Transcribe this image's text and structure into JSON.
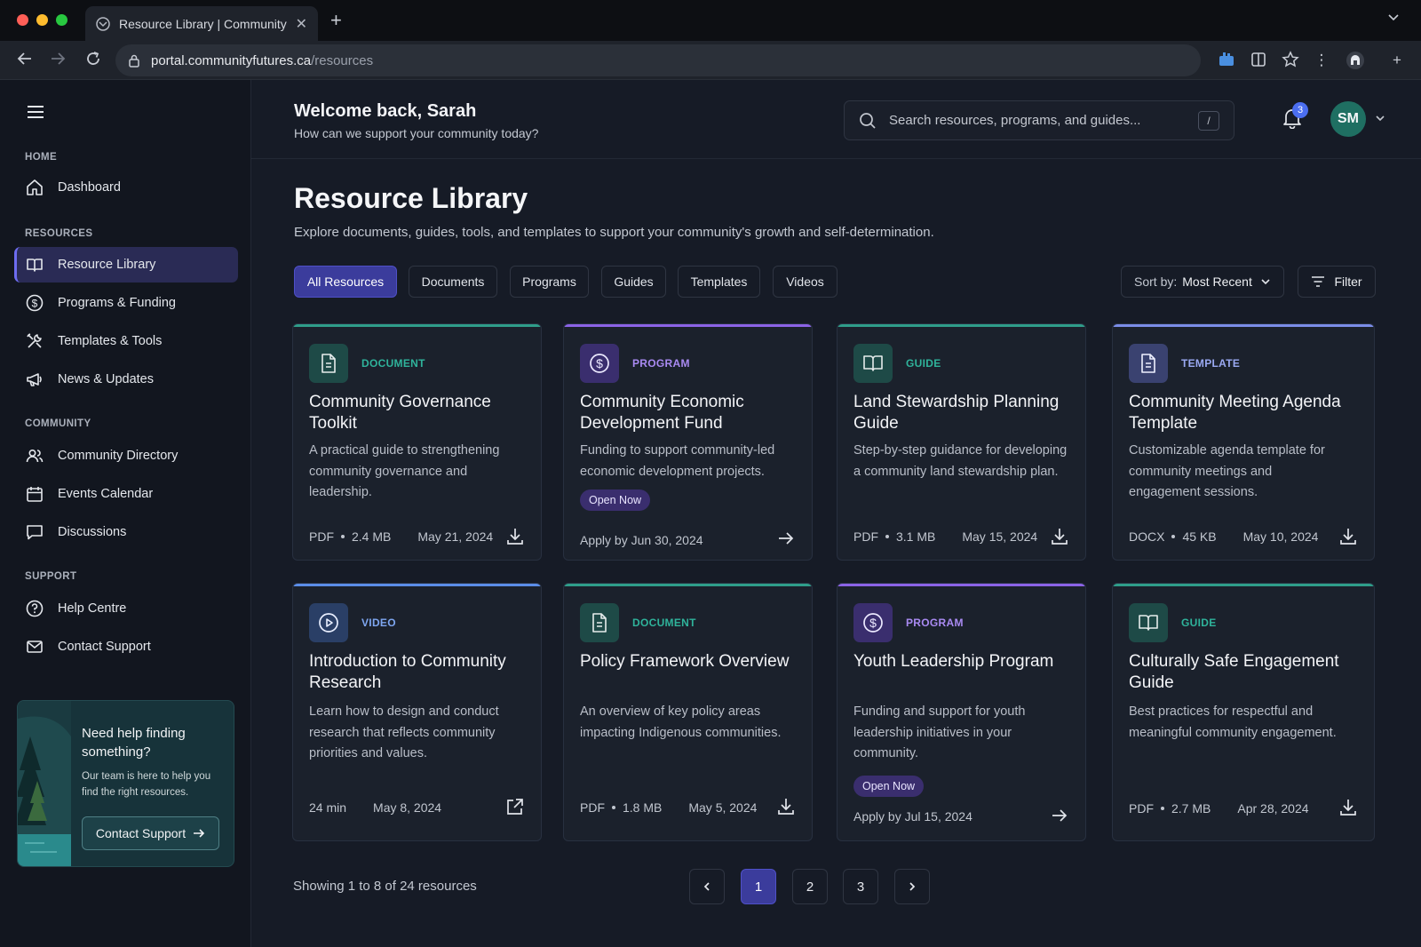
{
  "browser": {
    "tab_title": "Resource Library | Community Futures",
    "url_host": "portal.communityfutures.ca",
    "url_path": "/resources"
  },
  "sidebar": {
    "sections": {
      "home": "HOME",
      "resources": "RESOURCES",
      "community": "COMMUNITY",
      "support": "SUPPORT"
    },
    "items": [
      {
        "label": "Dashboard",
        "icon": "home-icon"
      },
      {
        "label": "Resource Library",
        "icon": "book-icon",
        "active": true
      },
      {
        "label": "Programs & Funding",
        "icon": "dollar-icon"
      },
      {
        "label": "Templates & Tools",
        "icon": "tools-icon"
      },
      {
        "label": "News & Updates",
        "icon": "megaphone-icon"
      },
      {
        "label": "Community Directory",
        "icon": "users-icon"
      },
      {
        "label": "Events Calendar",
        "icon": "calendar-icon"
      },
      {
        "label": "Discussions",
        "icon": "chat-icon"
      },
      {
        "label": "Help Centre",
        "icon": "help-icon"
      },
      {
        "label": "Contact Support",
        "icon": "mail-icon"
      }
    ],
    "help_card": {
      "title": "Need help finding something?",
      "subtitle": "Our team is here to help you find the right resources.",
      "button": "Contact Support"
    }
  },
  "header": {
    "welcome": "Welcome back, Sarah",
    "welcome_sub": "How can we support your community today?",
    "search_placeholder": "Search resources, programs, and guides...",
    "search_shortcut": "/",
    "notification_count": "3",
    "avatar_initials": "SM"
  },
  "page": {
    "title": "Resource Library",
    "description": "Explore documents, guides, tools, and templates to support your community's growth and self-determination."
  },
  "filters": {
    "chips": [
      "All Resources",
      "Documents",
      "Programs",
      "Guides",
      "Templates",
      "Videos"
    ],
    "active_chip": "All Resources",
    "sort_label": "Sort by:",
    "sort_value": "Most Recent",
    "filter_label": "Filter"
  },
  "colors": {
    "document": "#2f9e8a",
    "program": "#8b63e6",
    "guide": "#2f9e8a",
    "template": "#7b8de8",
    "video": "#5b8de8"
  },
  "cards": [
    {
      "type": "DOCUMENT",
      "title": "Community Governance Toolkit",
      "desc": "A practical guide to strengthening community governance and leadership.",
      "format": "PDF",
      "size": "2.4 MB",
      "date": "May 21, 2024",
      "action": "download-icon"
    },
    {
      "type": "PROGRAM",
      "title": "Community Economic Development Fund",
      "desc": "Funding to support community-led economic development projects.",
      "pill": "Open Now",
      "apply": "Apply by Jun 30, 2024",
      "action": "arrow-right-icon"
    },
    {
      "type": "GUIDE",
      "title": "Land Stewardship Planning Guide",
      "desc": "Step-by-step guidance for developing a community land stewardship plan.",
      "format": "PDF",
      "size": "3.1 MB",
      "date": "May 15, 2024",
      "action": "download-icon"
    },
    {
      "type": "TEMPLATE",
      "title": "Community Meeting Agenda Template",
      "desc": "Customizable agenda template for community meetings and engagement sessions.",
      "format": "DOCX",
      "size": "45 KB",
      "date": "May 10, 2024",
      "action": "download-icon"
    },
    {
      "type": "VIDEO",
      "title": "Introduction to Community Research",
      "desc": "Learn how to design and conduct research that reflects community priorities and values.",
      "duration": "24 min",
      "date": "May 8, 2024",
      "action": "external-link-icon"
    },
    {
      "type": "DOCUMENT",
      "title": "Policy Framework Overview",
      "desc": "An overview of key policy areas impacting Indigenous communities.",
      "format": "PDF",
      "size": "1.8 MB",
      "date": "May 5, 2024",
      "action": "download-icon"
    },
    {
      "type": "PROGRAM",
      "title": "Youth Leadership Program",
      "desc": "Funding and support for youth leadership initiatives in your community.",
      "pill": "Open Now",
      "apply": "Apply by Jul 15, 2024",
      "action": "arrow-right-icon"
    },
    {
      "type": "GUIDE",
      "title": "Culturally Safe Engagement Guide",
      "desc": "Best practices for respectful and meaningful community engagement.",
      "format": "PDF",
      "size": "2.7 MB",
      "date": "Apr 28, 2024",
      "action": "download-icon"
    }
  ],
  "pagination": {
    "summary": "Showing 1 to 8 of 24 resources",
    "pages": [
      "1",
      "2",
      "3"
    ],
    "current": "1"
  }
}
